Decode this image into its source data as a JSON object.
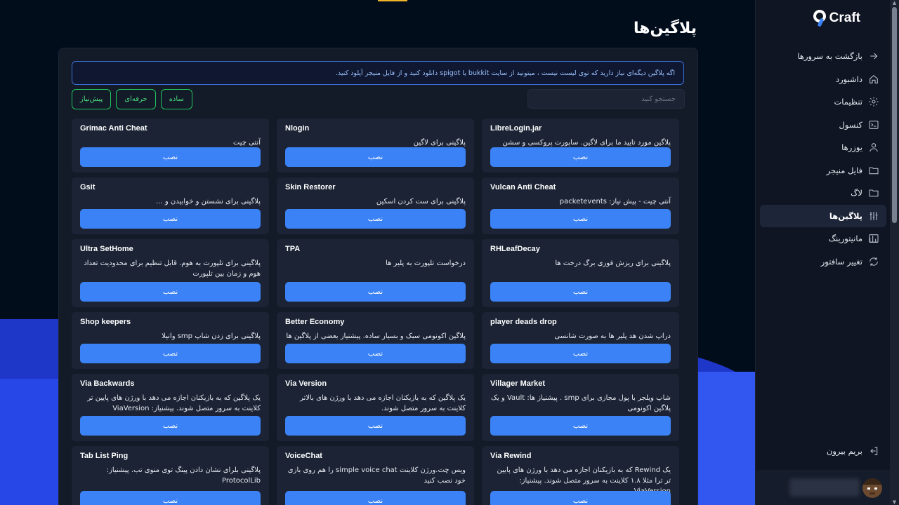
{
  "brand": {
    "logo_text": "Craft"
  },
  "page": {
    "title": "پلاگین‌ها"
  },
  "notice": "اگه پلاگین دیگه‌ای نیاز دارید که توی لیست نیست ، میتونید از سایت bukkit یا spigot دانلود کنید و از فایل منیجر آپلود کنید.",
  "search": {
    "placeholder": "جستجو کنید"
  },
  "filters": [
    "پیش‌نیاز",
    "حرفه‌ای",
    "ساده"
  ],
  "sidebar": {
    "items": [
      {
        "label": "بازگشت به سرورها",
        "icon": "arrow-right-icon"
      },
      {
        "label": "داشبورد",
        "icon": "home-icon"
      },
      {
        "label": "تنظیمات",
        "icon": "gear-icon"
      },
      {
        "label": "کنسول",
        "icon": "terminal-icon"
      },
      {
        "label": "یوزرها",
        "icon": "user-icon"
      },
      {
        "label": "فایل منیجر",
        "icon": "folder-icon"
      },
      {
        "label": "لاگ",
        "icon": "folder-icon"
      },
      {
        "label": "پلاگین‌ها",
        "icon": "sliders-icon",
        "active": true
      },
      {
        "label": "مانیتورینگ",
        "icon": "bar-chart-icon"
      },
      {
        "label": "تغییر سافتور",
        "icon": "refresh-icon"
      }
    ],
    "logout_label": "بریم بیرون"
  },
  "install_label": "نصب",
  "plugins": [
    {
      "name": "Grimac Anti Cheat",
      "desc": "آنتی چیت"
    },
    {
      "name": "Nlogin",
      "desc": "پلاگینی برای لاگین"
    },
    {
      "name": "LibreLogin.jar",
      "desc": "پلاگین مورد تایید ما برای لاگین. ساپورت پروکسی و سشن"
    },
    {
      "name": "Gsit",
      "desc": "پلاگینی برای نشستن و خوابیدن و ..."
    },
    {
      "name": "Skin Restorer",
      "desc": "پلاگینی برای ست کردن اسکین"
    },
    {
      "name": "Vulcan Anti Cheat",
      "desc": "آنتی چیت - پیش نیاز: packetevents"
    },
    {
      "name": "Ultra SetHome",
      "desc": "پلاگینی برای تلپورت به هوم. قابل تنظیم برای محدودیت تعداد هوم و زمان بین تلپورت"
    },
    {
      "name": "TPA",
      "desc": "درخواست تلپورت به پلیر ها"
    },
    {
      "name": "RHLeafDecay",
      "desc": "پلاگینی برای ریزش فوری برگ درخت ها"
    },
    {
      "name": "Shop keepers",
      "desc": "پلاگینی برای زدن شاپ smp وانیلا"
    },
    {
      "name": "Better Economy",
      "desc": "پلاگین اکونومی سبک و بسیار ساده. پیشنیاز بعضی از پلاگین ها"
    },
    {
      "name": "player deads drop",
      "desc": "دراپ شدن هد پلیر ها به صورت شانسی"
    },
    {
      "name": "Via Backwards",
      "desc": "یک پلاگین که به بازیکنان اجازه می دهد با ورژن های پایین تر کلاینت به سرور متصل شوند. پیشنیاز: ViaVersion"
    },
    {
      "name": "Via Version",
      "desc": "یک پلاگین که به بازیکنان اجازه می دهد با ورژن های بالاتر کلاینت به سرور متصل شوند."
    },
    {
      "name": "Villager Market",
      "desc": "شاپ ویلجر با پول مجازی برای smp . پیشنیاز ها: Vault و یک پلاگین اکونومی"
    },
    {
      "name": "Tab List Ping",
      "desc": "پلاگینی بلرای نشان دادن پینگ توی منوی تب. پیشنیاز: ProtocolLib"
    },
    {
      "name": "VoiceChat",
      "desc": "ویس چت.ورژن کلاینت simple voice chat را هم روی بازی خود نصب کنید"
    },
    {
      "name": "Via Rewind",
      "desc": "یک Rewind که به بازیکنان اجازه می دهد با ورژن های پایین تر ترا مثلا ۱.۸ کلاینت به سرور متصل شوند. پیشنیاز: ViaVersion"
    }
  ]
}
